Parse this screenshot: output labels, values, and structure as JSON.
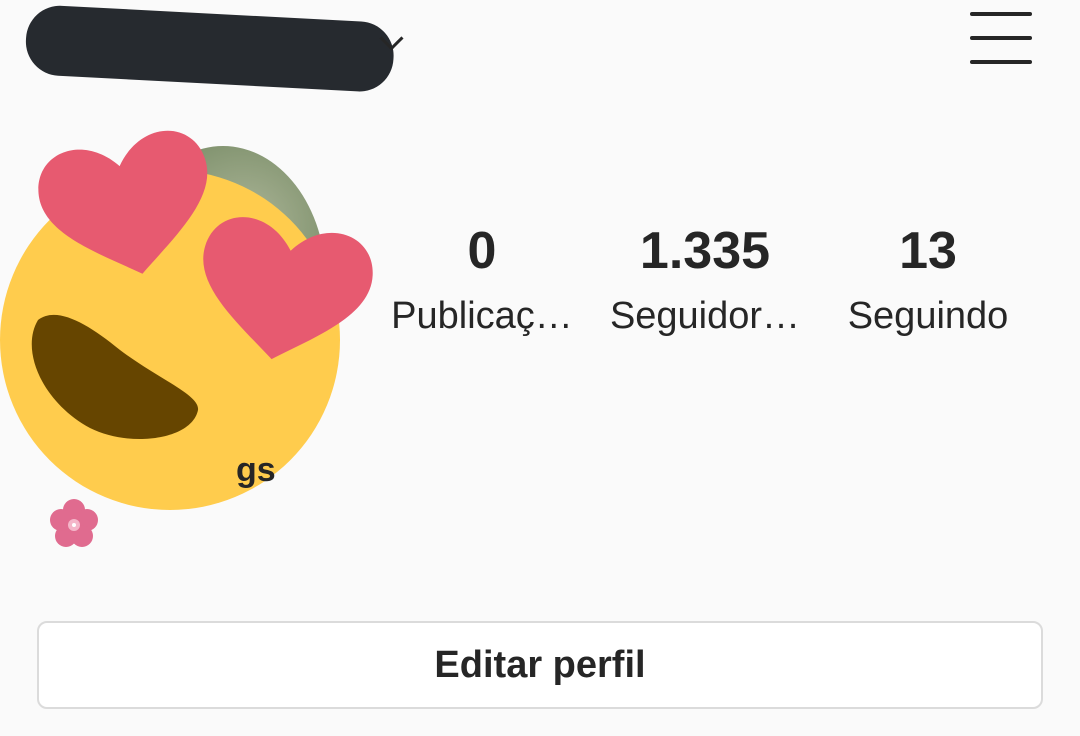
{
  "header": {
    "username_redacted": true,
    "username_dropdown_icon": "chevron-down-icon",
    "menu_icon": "hamburger-menu-icon"
  },
  "profile": {
    "avatar_overlay_icon": "smiling-face-with-heart-eyes-emoji",
    "stats": [
      {
        "value": "0",
        "label": "Publicaç…"
      },
      {
        "value": "1.335",
        "label": "Seguidor…"
      },
      {
        "value": "13",
        "label": "Seguindo"
      }
    ],
    "bio_name_visible": "gs",
    "bio_icon": "cherry-blossom-icon"
  },
  "actions": {
    "edit_profile_label": "Editar perfil"
  },
  "colors": {
    "background": "#fafafa",
    "text": "#262626",
    "button_border": "#dbdbdb",
    "emoji_face": "#ffcc4d",
    "emoji_heart": "#e75a70",
    "emoji_mouth": "#664500",
    "flower": "#e06b8f"
  }
}
